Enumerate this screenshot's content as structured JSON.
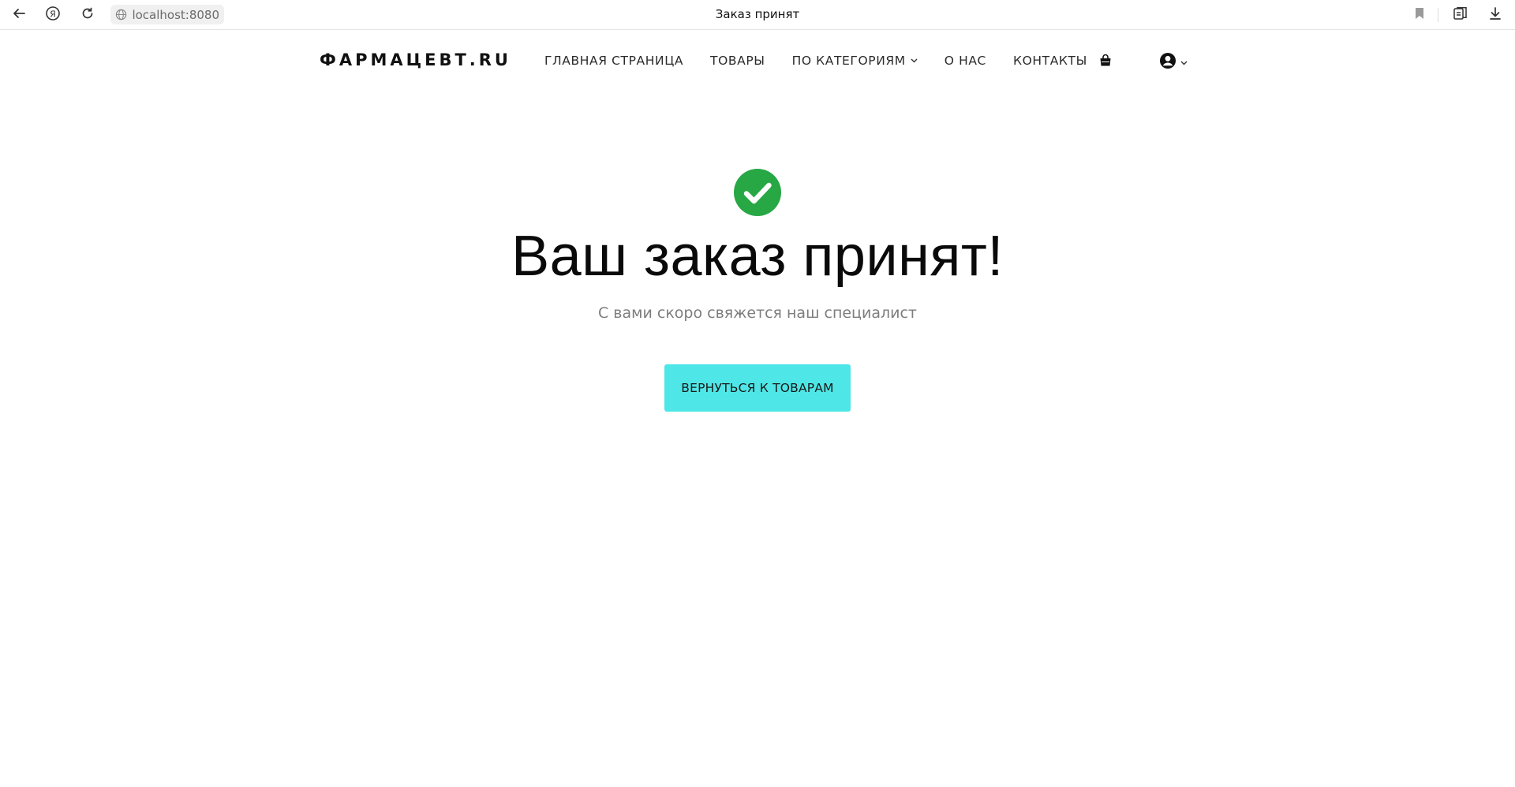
{
  "browser": {
    "url": "localhost:8080",
    "tab_title": "Заказ принят",
    "icons": [
      "back-icon",
      "yandex-icon",
      "reload-icon",
      "globe-icon",
      "bookmark-icon",
      "collections-icon",
      "download-icon"
    ]
  },
  "header": {
    "logo": "ФАРМАЦЕВТ.RU",
    "nav": {
      "home": "ГЛАВНАЯ СТРАНИЦА",
      "products": "ТОВАРЫ",
      "categories": "ПО КАТЕГОРИЯМ",
      "about": "О НАС",
      "contacts": "КОНТАКТЫ"
    },
    "icons": [
      "cart-icon",
      "user-icon",
      "chevron-down-icon"
    ]
  },
  "main": {
    "title": "Ваш заказ принят!",
    "subtitle": "С вами скоро свяжется наш специалист",
    "button_label": "ВЕРНУТЬСЯ К ТОВАРАМ"
  },
  "colors": {
    "success": "#28a745",
    "button_bg": "#4ee6e6",
    "subtitle": "#7d7d7d"
  }
}
